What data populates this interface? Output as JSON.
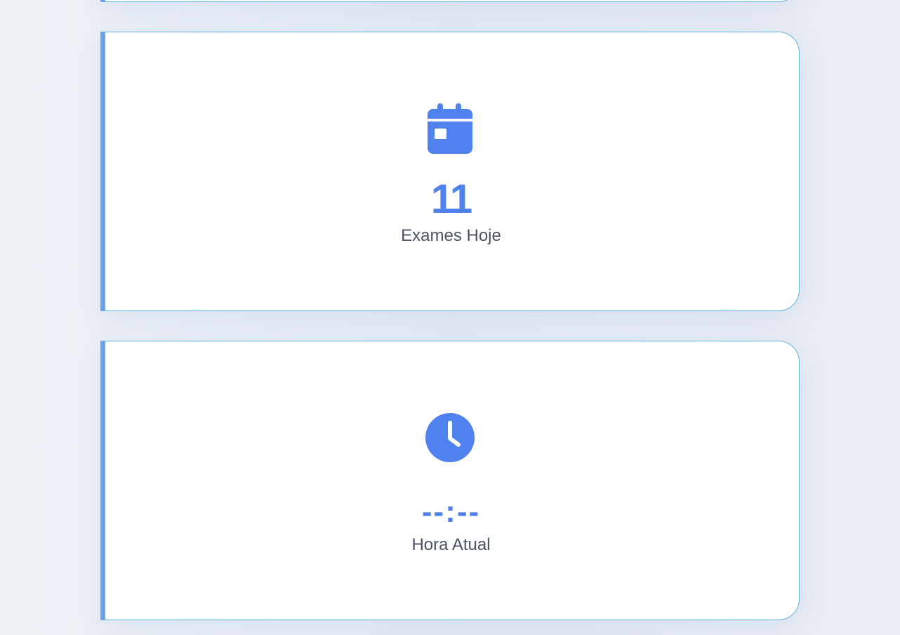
{
  "cards": [
    {
      "icon": "calendar-icon",
      "value": "11",
      "label": "Exames Hoje"
    },
    {
      "icon": "clock-icon",
      "value": "--:--",
      "label": "Hora Atual"
    }
  ],
  "colors": {
    "accent": "#4f82ef",
    "card_border": "#5fb6ea",
    "card_left_border": "#6aa5ee",
    "label_text": "#4a5263",
    "card_background": "#ffffff"
  }
}
